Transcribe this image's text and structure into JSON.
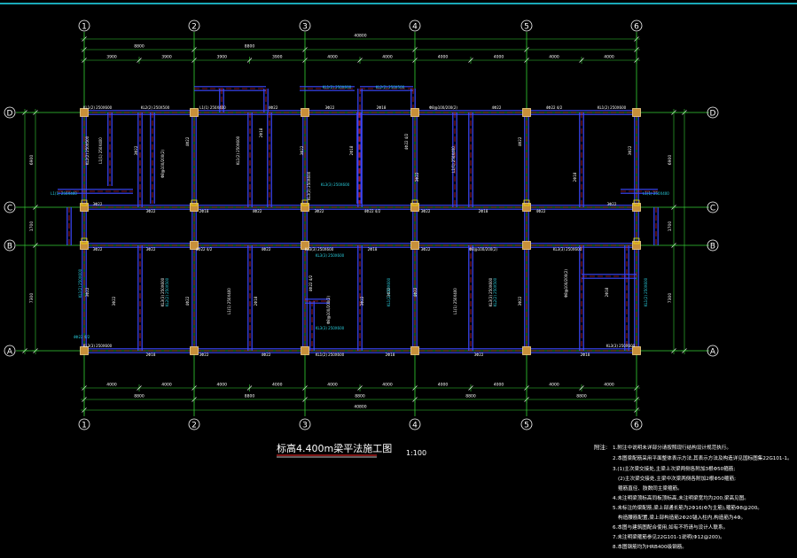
{
  "colors": {
    "background": "#000000",
    "axis": "#34d134",
    "beam": "#3c48ff",
    "beam_center": "#ff2a2a",
    "column": "#c8903a",
    "text": "#ffffff",
    "note": "#2ad0e0",
    "annotation": "#f0e000"
  },
  "grid": {
    "vertical_labels": [
      "1",
      "2",
      "3",
      "4",
      "5",
      "6"
    ],
    "horizontal_labels": [
      "D",
      "C",
      "B",
      "A"
    ]
  },
  "dimensions": {
    "top_total": "40800",
    "top_groups": [
      "8800",
      "8800",
      "",
      "",
      "",
      ""
    ],
    "top_spans": [
      "3900",
      "3900",
      "3900",
      "3900",
      "4000",
      "4000",
      "4000",
      "4000",
      "4000",
      "4000"
    ],
    "bottom_spans": [
      "4000",
      "4000",
      "4000",
      "4000",
      "4000",
      "4000",
      "4000",
      "4000",
      "4000",
      "4000"
    ],
    "bottom_groups": [
      "8800",
      "8800",
      "8800",
      "8800",
      "8800"
    ],
    "bottom_total": "40800",
    "left_bays": [
      "6900",
      "1700",
      "7300"
    ],
    "right_bays": [
      "6900",
      "1700",
      "7300"
    ]
  },
  "beam_labels": [
    "KL1(2) 250X600",
    "KL2(2) 250X500",
    "L1(1) 250X400",
    "4Φ22",
    "3Φ22",
    "2Φ18",
    "Φ8@100/200(2)",
    "4Φ22 4/2",
    "3Φ22",
    "KL3(3) 250X600"
  ],
  "title": {
    "main": "标高4.400m梁平法施工图",
    "scale": "1:100"
  },
  "notes": {
    "heading": "附注:",
    "lines": [
      "1.附注中说明未详部分请按照现行结构设计规范执行。",
      "2.本图梁配筋采用平面整体表示方法,其表示方法及构造详见国标图集22G101-1。",
      "3.(1)主次梁交接处,主梁上次梁两侧各附加3根Φ50箍筋;",
      "(2)主次梁交接处,主梁中次梁两侧各附加2根Φ50箍筋;",
      "箍筋直径、肢数同主梁箍筋。",
      "4.未注明梁顶标高同板顶标高,未注明梁宽均为200,梁高见图。",
      "5.未标注的梁配筋,梁上部通长筋为2Φ16(Φ为主筋),箍筋Φ8@200。",
      "构造腰筋配置,梁上部构造筋2Φ20锚入柱内,构造筋为4Φ。",
      "6.本图与建筑图配合使用,如有不符请与设计人联系。",
      "7.未注明梁箍筋参见22G101-1说明(Φ12@200)。",
      "8.本图钢筋均为HRB400级钢筋。"
    ]
  }
}
